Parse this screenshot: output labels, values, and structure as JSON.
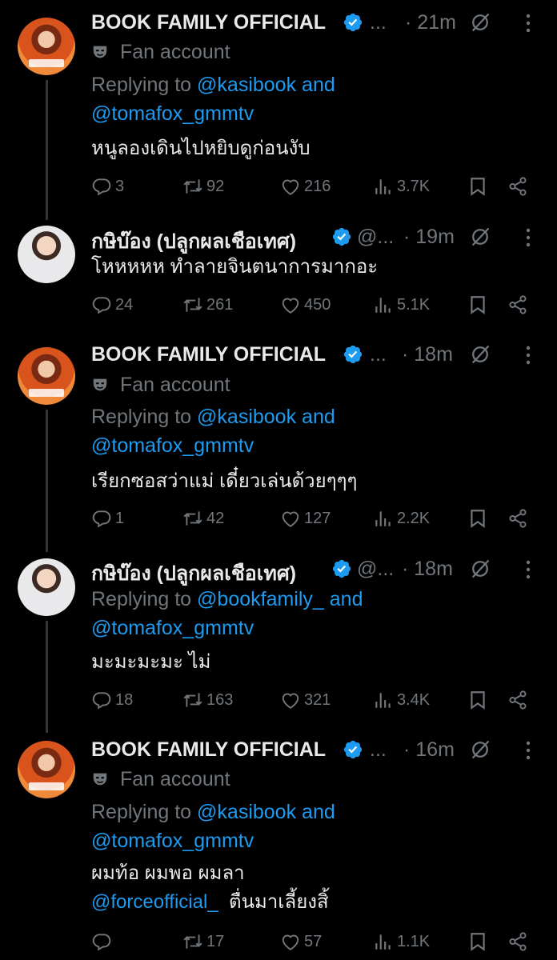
{
  "tweets": [
    {
      "name": "BOOK FAMILY OFFICIAL",
      "handle": "...",
      "time": "· 21m",
      "fan_label": "Fan account",
      "reply_prefix": "Replying to",
      "reply_user1": "@kasibook",
      "reply_and": "and",
      "reply_user2": "@tomafox_gmmtv",
      "text": "หนูลองเดินไปหยิบดูก่อนงับ",
      "replies": "3",
      "retweets": "92",
      "likes": "216",
      "views": "3.7K"
    },
    {
      "name": "กษิบ๊อง (ปลูกผลเชือเทศ)",
      "handle": "@...",
      "time": "· 19m",
      "text": "โหหหหห ทำลายจินตนาการมากอะ",
      "replies": "24",
      "retweets": "261",
      "likes": "450",
      "views": "5.1K"
    },
    {
      "name": "BOOK FAMILY OFFICIAL",
      "handle": "...",
      "time": "· 18m",
      "fan_label": "Fan account",
      "reply_prefix": "Replying to",
      "reply_user1": "@kasibook",
      "reply_and": "and",
      "reply_user2": "@tomafox_gmmtv",
      "text": "เรียกซอสว่าแม่ เดี๋ยวเล่นด้วยๆๆๆ",
      "replies": "1",
      "retweets": "42",
      "likes": "127",
      "views": "2.2K"
    },
    {
      "name": "กษิบ๊อง (ปลูกผลเชือเทศ)",
      "handle": "@...",
      "time": "· 18m",
      "reply_prefix": "Replying to",
      "reply_user1": "@bookfamily_",
      "reply_and": "and",
      "reply_user2": "@tomafox_gmmtv",
      "text": "มะมะมะมะ ไม่",
      "replies": "18",
      "retweets": "163",
      "likes": "321",
      "views": "3.4K"
    },
    {
      "name": "BOOK FAMILY OFFICIAL",
      "handle": "...",
      "time": "· 16m",
      "fan_label": "Fan account",
      "reply_prefix": "Replying to",
      "reply_user1": "@kasibook",
      "reply_and": "and",
      "reply_user2": "@tomafox_gmmtv",
      "text_line1": "ผมท้อ ผมพอ ผมลา",
      "mention": "@forceofficial_",
      "text_line2_suffix": "ตื่นมาเลี้ยงสิ้",
      "replies": "",
      "retweets": "17",
      "likes": "57",
      "views": "1.1K"
    }
  ],
  "colors": {
    "background": "#000000",
    "text": "#e7e9ea",
    "muted": "#71767b",
    "link": "#1d9bf0",
    "verified": "#1d9bf0"
  },
  "icons": [
    "verified-badge-icon",
    "grok-icon",
    "more-icon",
    "fan-mask-icon",
    "reply-icon",
    "retweet-icon",
    "like-icon",
    "views-icon",
    "bookmark-icon",
    "share-icon"
  ]
}
